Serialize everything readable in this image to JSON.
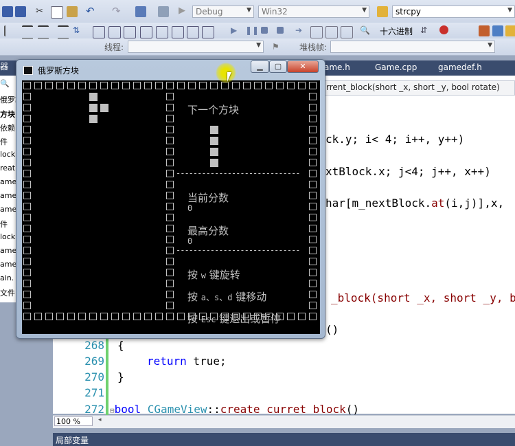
{
  "toolbar": {
    "config": "Debug",
    "platform": "Win32",
    "search": "strcpy",
    "hex_label": "十六进制",
    "thread_label": "线程:",
    "stack_label": "堆栈帧:"
  },
  "tabs": [
    "ame.h",
    "Game.cpp",
    "gamedef.h"
  ],
  "navbar": "rrent_block(short _x, short _y, bool rotate)",
  "sidebar": [
    "器",
    "俄罗斯",
    "方块",
    "依赖",
    "件",
    "lock",
    "reat",
    "ame",
    "ame",
    "ame",
    "件",
    "lock",
    "ame",
    "ame",
    "ain.",
    "文件"
  ],
  "code": {
    "l1": "ck.y; i< 4; i++, y++)",
    "l2": "xtBlock.x; j<4; j++, x++)",
    "l3_a": "har[m_nextBlock.",
    "l3_b": "at",
    "l3_c": "(i,j)],x,",
    "l4": "_block(short _x, short _y, b",
    "l5": "()",
    "ln268": "268",
    "ln269": "269",
    "ln270": "270",
    "ln271": "271",
    "ln272": "272",
    "c268": "{",
    "c269_kw": "return",
    "c269_rest": " true;",
    "c270": "}",
    "c272_kw": "bool",
    "c272_cls": " CGameView",
    "c272_sep": "::",
    "c272_fn": "create_curret_block",
    "c272_tail": "()"
  },
  "zoom": "100 %",
  "bottom_panel": "局部变量",
  "console_window": {
    "title": "俄罗斯方块",
    "next_label": "下一个方块",
    "dashes": "-----------------------------",
    "score_label": "当前分数",
    "score": "0",
    "best_label": "最高分数",
    "best": "0",
    "help1_a": "按 ",
    "help1_key": "w",
    "help1_b": " 键旋转",
    "help2_a": "按 ",
    "help2_key": "a、s、d",
    "help2_b": " 键移动",
    "help3_a": "按 ",
    "help3_key": "Esc",
    "help3_b": " 键退出或暂停"
  }
}
